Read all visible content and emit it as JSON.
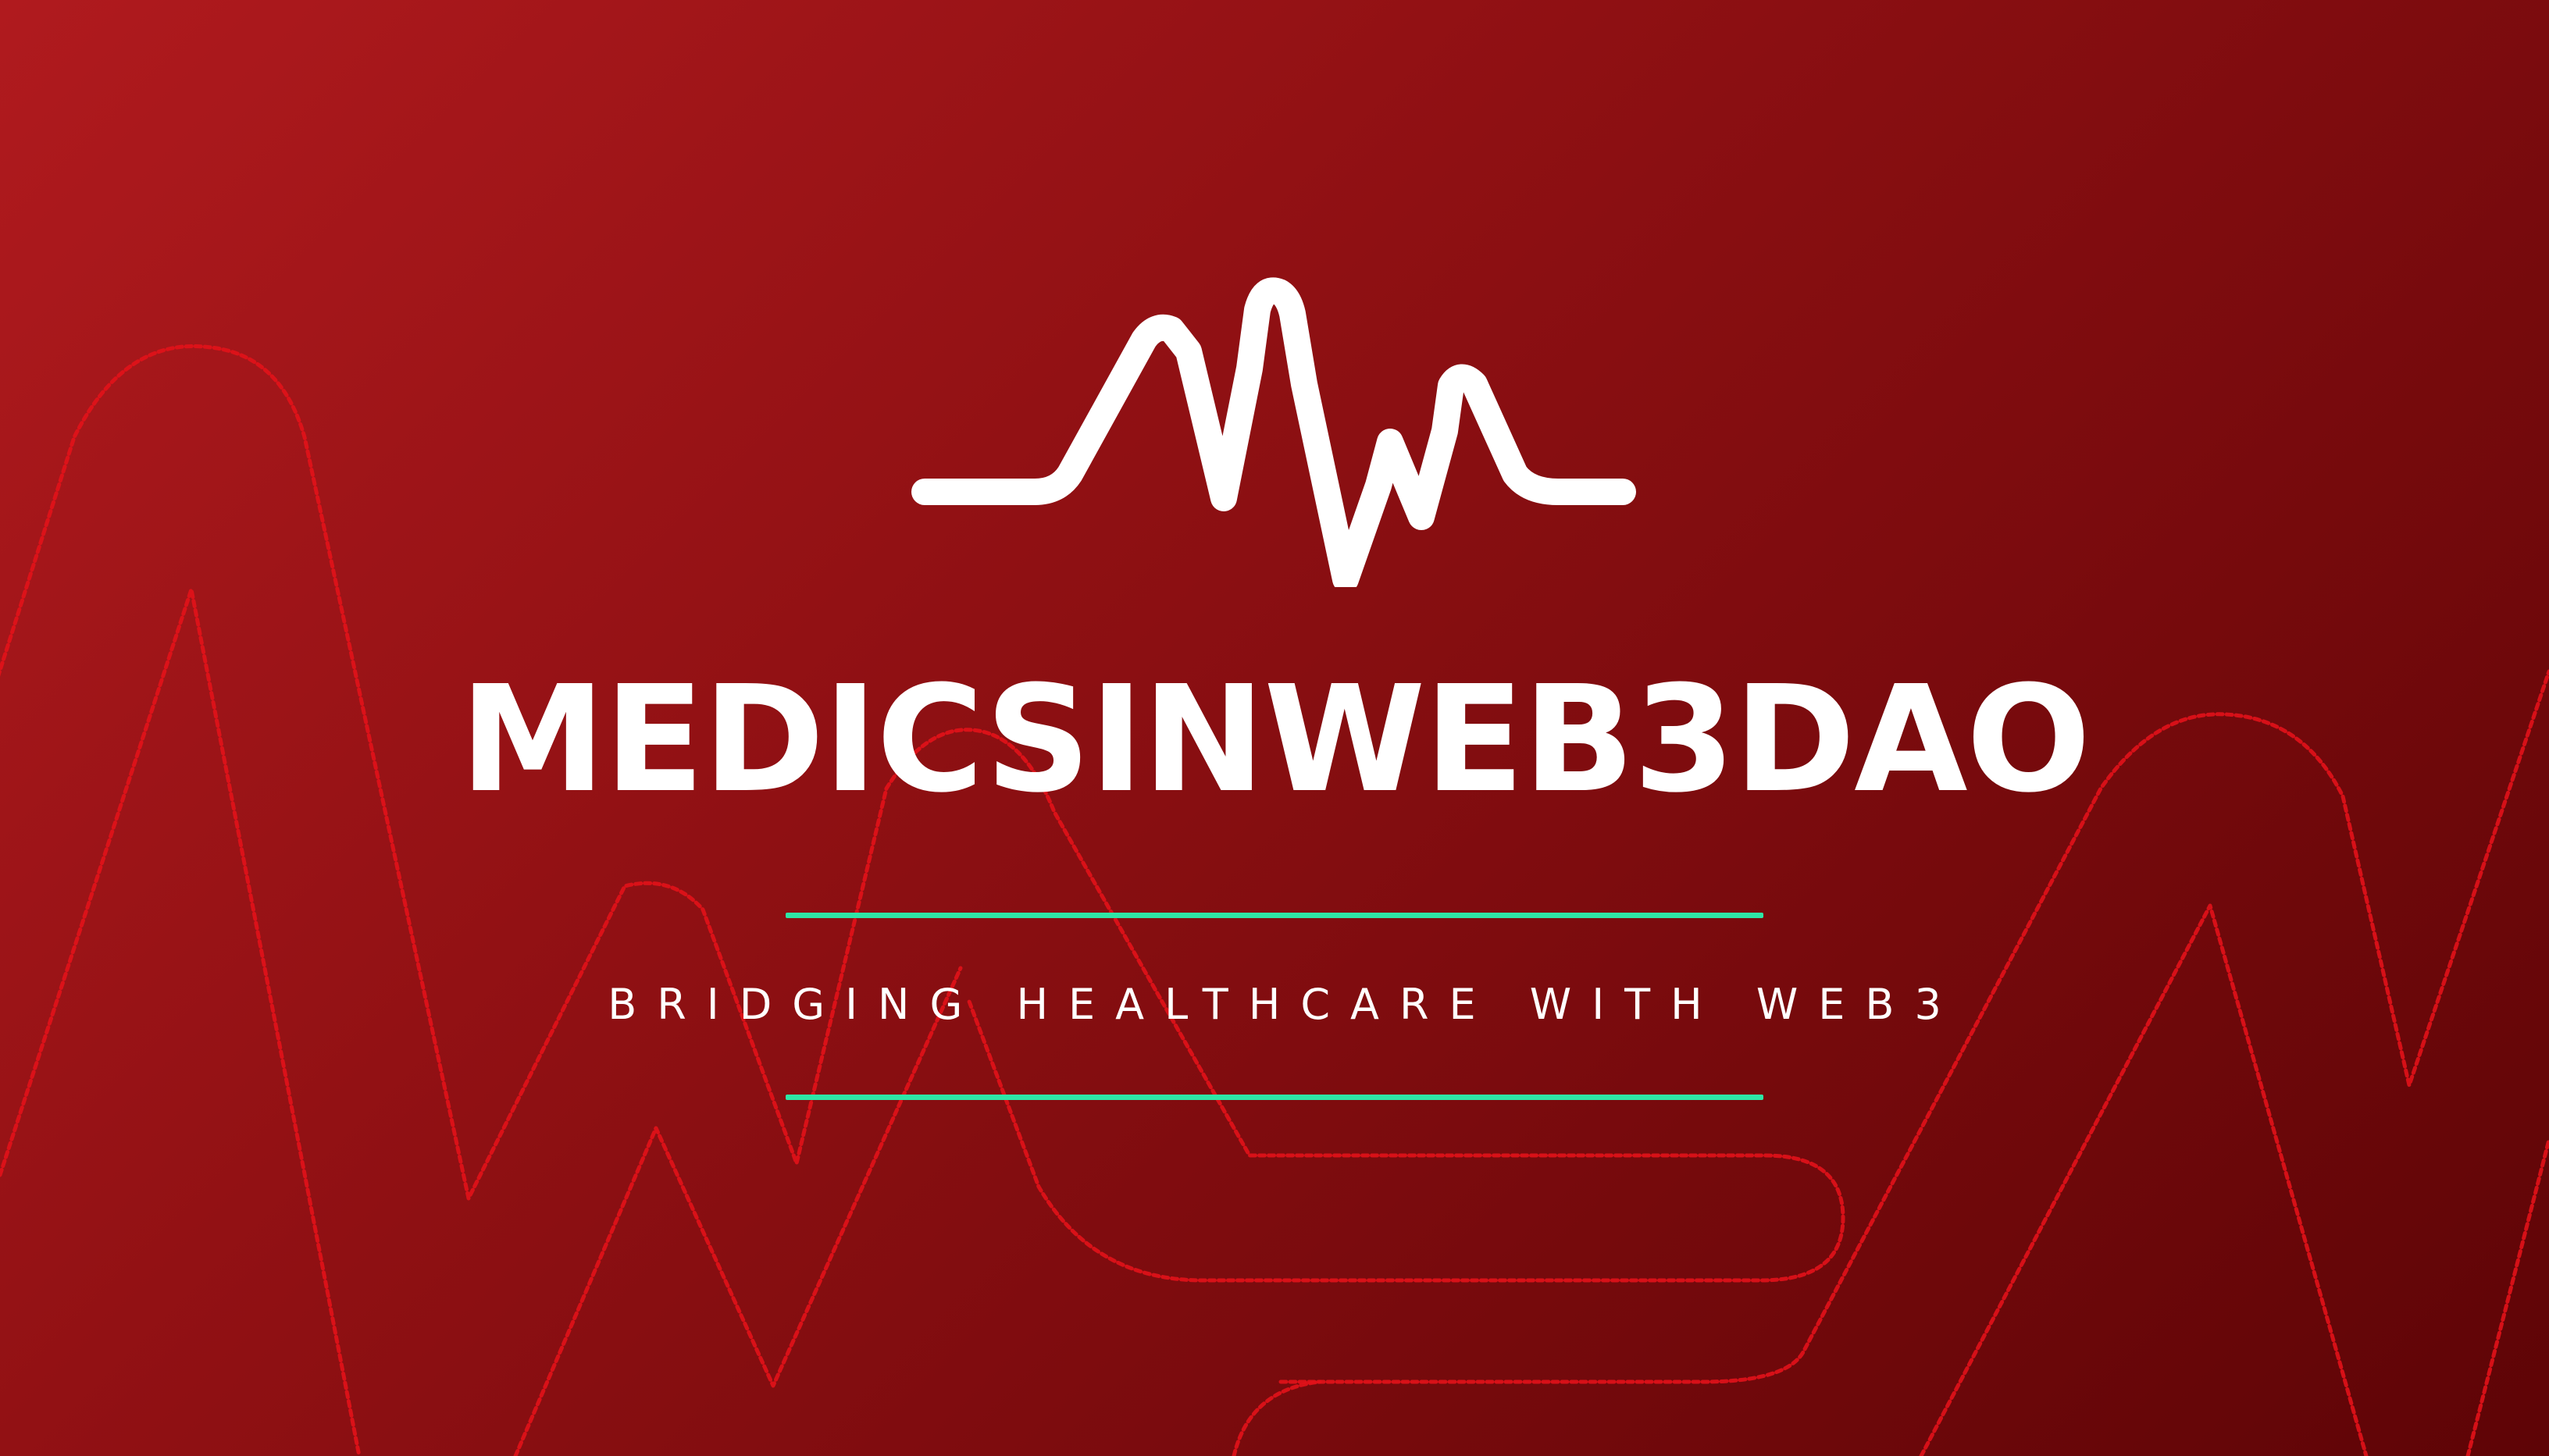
{
  "banner": {
    "title": "MEDICSINWEB3DAO",
    "tagline": "BRIDGING HEALTHCARE WITH WEB3",
    "logo_icon": "heartbeat-pulse-icon",
    "colors": {
      "background_start": "#b01a1e",
      "background_end": "#5e0406",
      "pattern_lines": "#e2121a",
      "divider": "#2ee6a6",
      "text": "#ffffff"
    }
  }
}
